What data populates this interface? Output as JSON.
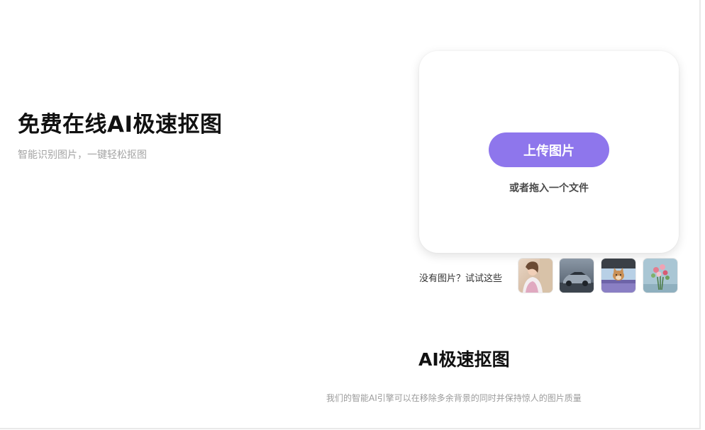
{
  "hero": {
    "title": "免费在线AI极速抠图",
    "subtitle": "智能识别图片，一键轻松抠图"
  },
  "upload": {
    "button_label": "上传图片",
    "drop_hint": "或者拖入一个文件",
    "accent_color": "#8e76ec"
  },
  "samples": {
    "label": "没有图片？试试这些",
    "items": [
      {
        "icon": "woman-portrait-thumbnail"
      },
      {
        "icon": "car-thumbnail"
      },
      {
        "icon": "pet-in-car-thumbnail"
      },
      {
        "icon": "flower-bouquet-thumbnail"
      }
    ]
  },
  "section": {
    "title": "AI极速抠图",
    "description": "我们的智能AI引擎可以在移除多余背景的同时并保持惊人的图片质量"
  }
}
